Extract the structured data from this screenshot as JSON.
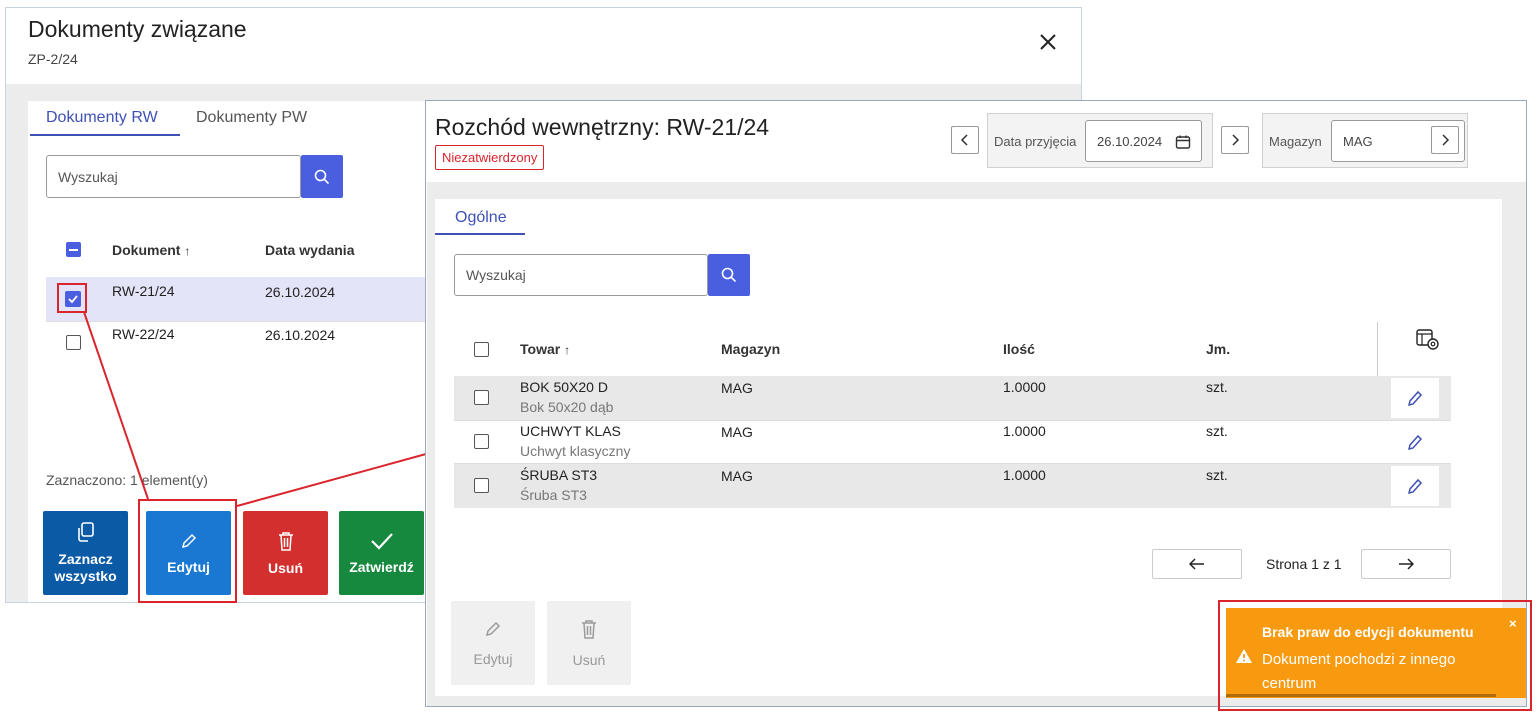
{
  "dialog1": {
    "title": "Dokumenty związane",
    "subtitle": "ZP-2/24",
    "tabs": [
      "Dokumenty RW",
      "Dokumenty PW"
    ],
    "search_placeholder": "Wyszukaj",
    "columns": {
      "document": "Dokument",
      "date": "Data wydania"
    },
    "rows": [
      {
        "document": "RW-21/24",
        "date": "26.10.2024",
        "checked": true
      },
      {
        "document": "RW-22/24",
        "date": "26.10.2024",
        "checked": false
      }
    ],
    "selected_info": "Zaznaczono: 1 element(y)",
    "buttons": {
      "select_all_1": "Zaznacz",
      "select_all_2": "wszystko",
      "edit": "Edytuj",
      "delete": "Usuń",
      "approve": "Zatwierdź"
    },
    "colors": {
      "select_all": "#0b5aa6",
      "edit": "#1a78d2",
      "delete": "#d32f2f",
      "approve": "#16893e"
    }
  },
  "window2": {
    "title": "Rozchód wewnętrzny: RW-21/24",
    "status_badge": "Niezatwierdzony",
    "date_label": "Data przyjęcia",
    "date_value": "26.10.2024",
    "warehouse_label": "Magazyn",
    "warehouse_value": "MAG",
    "tab": "Ogólne",
    "search_placeholder": "Wyszukaj",
    "columns": {
      "item": "Towar",
      "warehouse": "Magazyn",
      "qty": "Ilość",
      "unit": "Jm."
    },
    "rows": [
      {
        "code": "BOK 50X20 D",
        "name": "Bok 50x20 dąb",
        "warehouse": "MAG",
        "qty": "1.0000",
        "unit": "szt."
      },
      {
        "code": "UCHWYT KLAS",
        "name": "Uchwyt klasyczny",
        "warehouse": "MAG",
        "qty": "1.0000",
        "unit": "szt."
      },
      {
        "code": "ŚRUBA ST3",
        "name": "Śruba ST3",
        "warehouse": "MAG",
        "qty": "1.0000",
        "unit": "szt."
      }
    ],
    "pagination": "Strona 1 z 1",
    "buttons": {
      "edit": "Edytuj",
      "delete": "Usuń"
    }
  },
  "toast": {
    "title": "Brak praw do edycji dokumentu",
    "message": "Dokument pochodzi z innego centrum",
    "close": "×",
    "color": "#f79a0f"
  },
  "annotation_color": "#d9252b"
}
